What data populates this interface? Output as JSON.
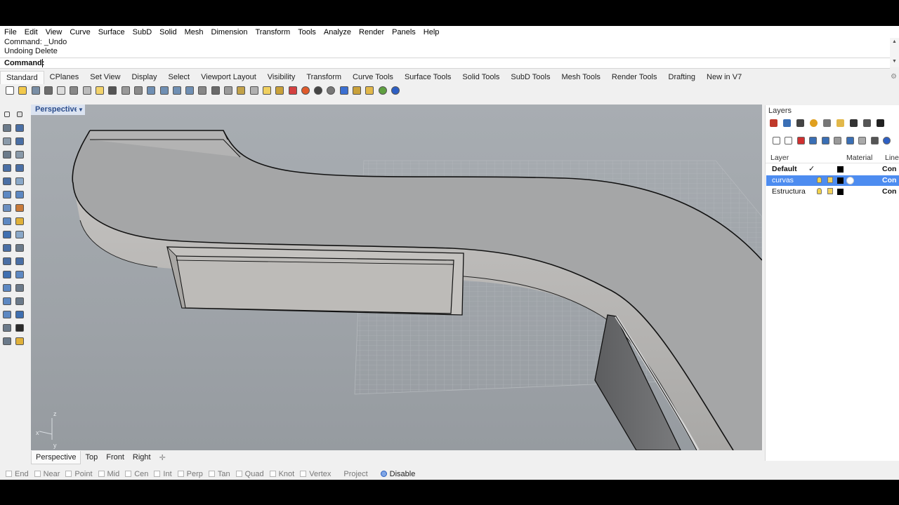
{
  "menu": [
    "File",
    "Edit",
    "View",
    "Curve",
    "Surface",
    "SubD",
    "Solid",
    "Mesh",
    "Dimension",
    "Transform",
    "Tools",
    "Analyze",
    "Render",
    "Panels",
    "Help"
  ],
  "command": {
    "history": [
      "Command: _Undo",
      "Undoing Delete"
    ],
    "prompt": "Command:"
  },
  "toolbar_tabs": [
    "Standard",
    "CPlanes",
    "Set View",
    "Display",
    "Select",
    "Viewport Layout",
    "Visibility",
    "Transform",
    "Curve Tools",
    "Surface Tools",
    "Solid Tools",
    "SubD Tools",
    "Mesh Tools",
    "Render Tools",
    "Drafting",
    "New in V7"
  ],
  "active_toolbar_tab": "Standard",
  "toolbar_icons": [
    "new-icon",
    "open-icon",
    "save-icon",
    "print-icon",
    "import-icon",
    "cut-icon",
    "copy-icon",
    "paste-icon",
    "undo-icon",
    "pan-icon",
    "rotate-view-icon",
    "zoom-icon",
    "zoom-window-icon",
    "zoom-extents-icon",
    "zoom-selected-icon",
    "set-view-icon",
    "four-viewports-icon",
    "grid-icon",
    "cplane-icon",
    "osnap-icon",
    "light-icon",
    "lock-icon",
    "select-icon",
    "color-wheel-icon",
    "sphere-icon",
    "render-icon",
    "material-icon",
    "texture-icon",
    "options-icon",
    "globe-icon",
    "help-icon"
  ],
  "viewport": {
    "label": "Perspective",
    "axes": {
      "z": "z",
      "x": "x",
      "y": "y"
    }
  },
  "view_tabs": [
    "Perspective",
    "Top",
    "Front",
    "Right"
  ],
  "active_view_tab": "Perspective",
  "osnaps": [
    {
      "label": "End",
      "checked": false
    },
    {
      "label": "Near",
      "checked": false
    },
    {
      "label": "Point",
      "checked": false
    },
    {
      "label": "Mid",
      "checked": false
    },
    {
      "label": "Cen",
      "checked": false
    },
    {
      "label": "Int",
      "checked": false
    },
    {
      "label": "Perp",
      "checked": false
    },
    {
      "label": "Tan",
      "checked": false
    },
    {
      "label": "Quad",
      "checked": false
    },
    {
      "label": "Knot",
      "checked": false
    },
    {
      "label": "Vertex",
      "checked": false
    }
  ],
  "status": {
    "project": "Project",
    "disable": "Disable"
  },
  "layers_panel": {
    "title": "Layers",
    "columns": {
      "layer": "Layer",
      "material": "Material",
      "linetype": "Line"
    },
    "layers": [
      {
        "name": "Default",
        "current": true,
        "selected": false,
        "color": "#000000",
        "linetype": "Con"
      },
      {
        "name": "curvas",
        "current": false,
        "selected": true,
        "color": "#000000",
        "linetype": "Con"
      },
      {
        "name": "Estructura",
        "current": false,
        "selected": false,
        "color": "#000000",
        "linetype": "Con"
      }
    ]
  },
  "colors": {
    "accent": "#4d8cf0",
    "viewport_bg": "#9aa0a5",
    "viewport_label": "#2b4d8c"
  }
}
